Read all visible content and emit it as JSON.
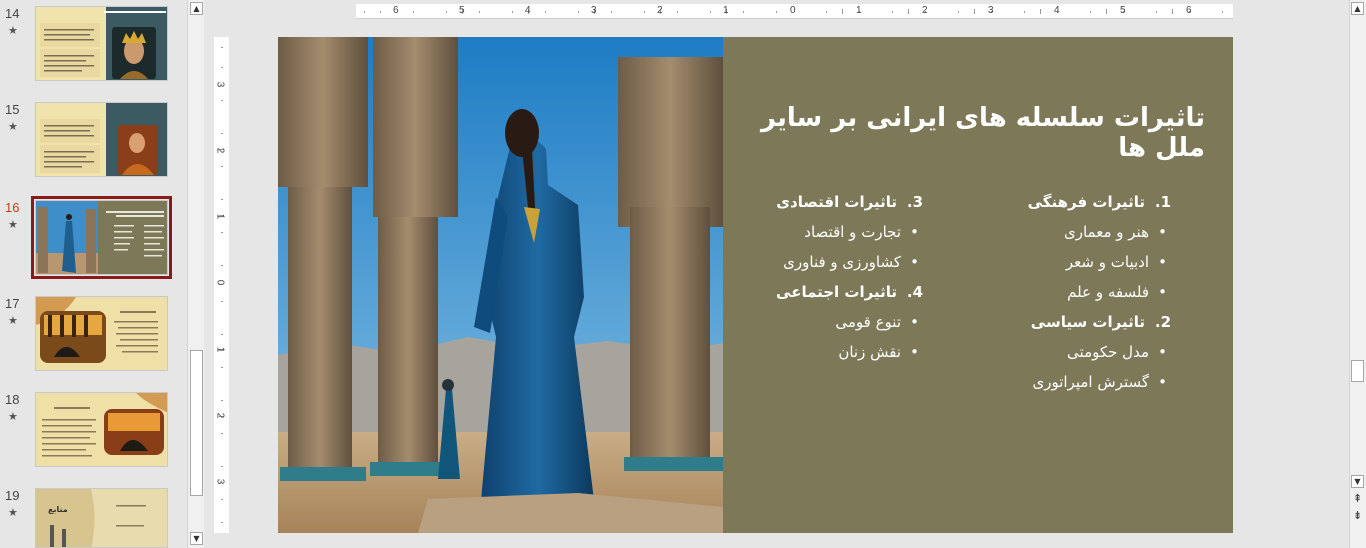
{
  "thumbnails": [
    {
      "number": "14",
      "star": "★",
      "title": "نقش زنان در سلسله های ایرانی"
    },
    {
      "number": "15",
      "star": "★",
      "title": "نقش زنان در سلسله های ایرانی"
    },
    {
      "number": "16",
      "star": "★",
      "title": "تاثیرات سلسله های ایرانی بر سایر ملل ها",
      "selected": true
    },
    {
      "number": "17",
      "star": "★",
      "title": "عوامل فروپاشی"
    },
    {
      "number": "18",
      "star": "★",
      "title": "عوامل فروپاشی"
    },
    {
      "number": "19",
      "star": "★",
      "title": "منابع"
    }
  ],
  "ruler": {
    "horizontal": [
      "6",
      "5",
      "4",
      "3",
      "2",
      "1",
      "0",
      "1",
      "2",
      "3",
      "4",
      "5",
      "6"
    ],
    "vertical": [
      "3",
      "2",
      "1",
      "0",
      "1",
      "2",
      "3"
    ]
  },
  "slide": {
    "title": "تاثیرات سلسله های ایرانی بر سایر ملل ها",
    "right_column": [
      {
        "kind": "head",
        "num": "1.",
        "text": "تاثیرات فرهنگی"
      },
      {
        "kind": "bullet",
        "text": "هنر و معماری"
      },
      {
        "kind": "bullet",
        "text": "ادبیات و شعر"
      },
      {
        "kind": "bullet",
        "text": "فلسفه و علم"
      },
      {
        "kind": "head",
        "num": "2.",
        "text": "تاثیرات سیاسی"
      },
      {
        "kind": "bullet",
        "text": "مدل حکومتی"
      },
      {
        "kind": "bullet",
        "text": "گسترش امپراتوری"
      }
    ],
    "left_column": [
      {
        "kind": "head",
        "num": "3.",
        "text": "تاثیرات اقتصادی"
      },
      {
        "kind": "bullet",
        "text": "تجارت و اقتصاد"
      },
      {
        "kind": "bullet",
        "text": "کشاورزی و فناوری"
      },
      {
        "kind": "head",
        "num": "4.",
        "text": "تاثیرات اجتماعی"
      },
      {
        "kind": "bullet",
        "text": "تنوع قومی"
      },
      {
        "kind": "bullet",
        "text": "نقش زنان"
      }
    ],
    "colors": {
      "background": "#7c7858",
      "text": "#ffffff",
      "sky": "#2b8fd1"
    }
  },
  "scroll": {
    "up": "▲",
    "down": "▼",
    "prev_slide": "⇞",
    "next_slide": "⇟"
  }
}
